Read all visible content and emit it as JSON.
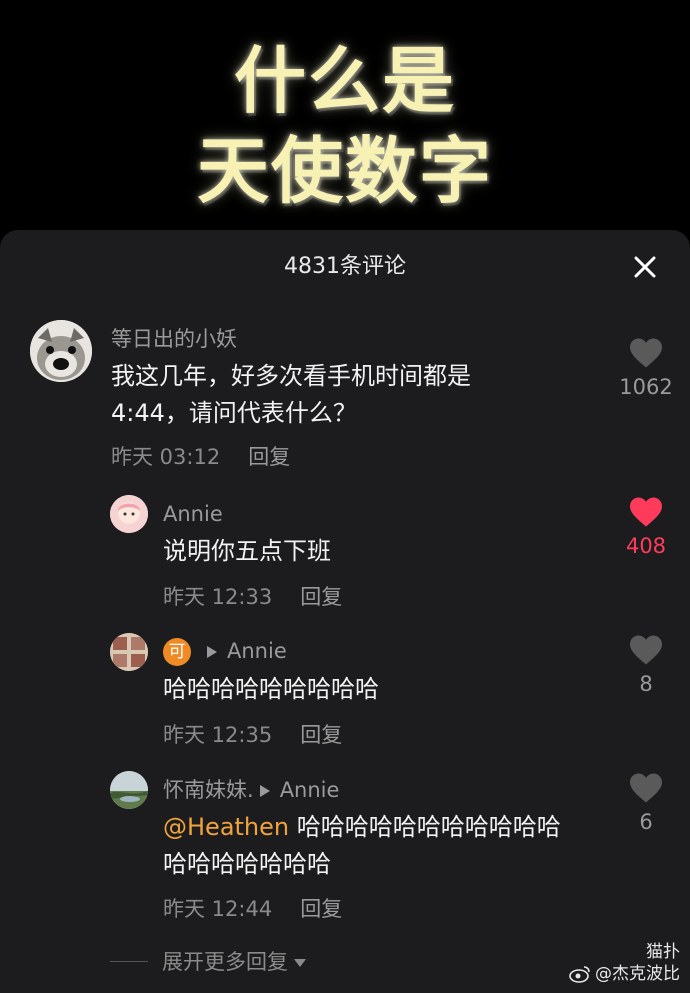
{
  "video": {
    "title_line1": "什么是",
    "title_line2": "天使数字"
  },
  "panel": {
    "header": "4831条评论"
  },
  "comments": [
    {
      "name": "等日出的小妖",
      "text_line1": "我这几年，好多次看手机时间都是",
      "text_line2": "4:44，请问代表什么？",
      "time": "昨天 03:12",
      "reply": "回复",
      "likes": "1062",
      "liked": false
    }
  ],
  "replies": [
    {
      "name": "Annie",
      "text": "说明你五点下班",
      "time": "昨天 12:33",
      "reply": "回复",
      "likes": "408",
      "liked": true
    },
    {
      "badge": "可",
      "to": "Annie",
      "text": "哈哈哈哈哈哈哈哈哈",
      "time": "昨天 12:35",
      "reply": "回复",
      "likes": "8",
      "liked": false
    },
    {
      "name": "怀南妹妹.",
      "to": "Annie",
      "mention": "@Heathen",
      "text_line1": " 哈哈哈哈哈哈哈哈哈哈哈",
      "text_line2": "哈哈哈哈哈哈哈",
      "time": "昨天 12:44",
      "reply": "回复",
      "likes": "6",
      "liked": false
    }
  ],
  "expand": {
    "label": "展开更多回复"
  },
  "watermark": {
    "line1": "猫扑",
    "line2": "@杰克波比"
  },
  "colors": {
    "accent_like": "#ff3b5c",
    "mention": "#f0a33a",
    "title": "#f7f1b4"
  }
}
